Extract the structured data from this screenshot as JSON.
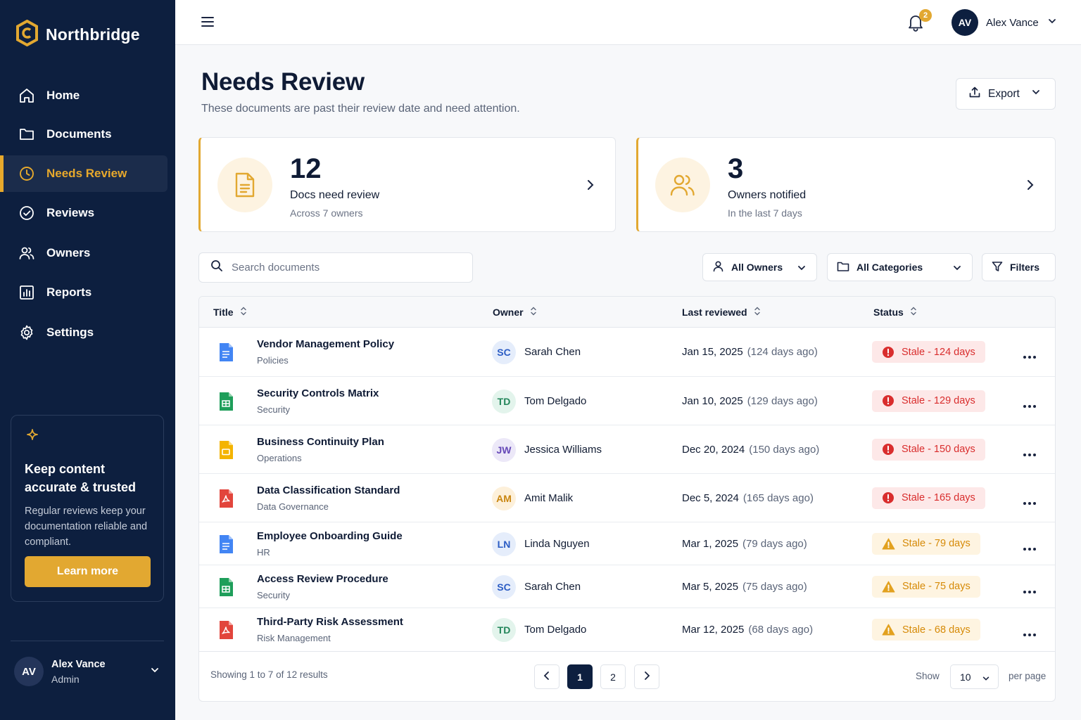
{
  "brand": {
    "name": "Northbridge"
  },
  "sidebar": {
    "items": [
      {
        "label": "Home",
        "icon": "home-icon"
      },
      {
        "label": "Documents",
        "icon": "folder-icon"
      },
      {
        "label": "Needs Review",
        "icon": "clock-icon",
        "active": true
      },
      {
        "label": "Reviews",
        "icon": "check-circle-icon"
      },
      {
        "label": "Owners",
        "icon": "users-icon"
      },
      {
        "label": "Reports",
        "icon": "bar-chart-icon"
      },
      {
        "label": "Settings",
        "icon": "gear-icon"
      }
    ],
    "promo": {
      "title": "Keep content accurate & trusted",
      "text": "Regular reviews keep your documentation reliable and compliant.",
      "button": "Learn more"
    },
    "user": {
      "initials": "AV",
      "name": "Alex Vance",
      "role": "Admin"
    }
  },
  "topbar": {
    "notification_count": "2",
    "user": {
      "initials": "AV",
      "name": "Alex Vance"
    }
  },
  "header": {
    "title": "Needs Review",
    "subtitle": "These documents are past their review date and need attention.",
    "export_label": "Export"
  },
  "stats": [
    {
      "value": "12",
      "label": "Docs need review",
      "sub": "Across 7 owners",
      "icon": "document-icon"
    },
    {
      "value": "3",
      "label": "Owners notified",
      "sub": "In the last 7 days",
      "icon": "users-icon"
    }
  ],
  "filters": {
    "search_placeholder": "Search documents",
    "owners": "All Owners",
    "categories": "All Categories",
    "more": "Filters"
  },
  "table": {
    "columns": [
      "Title",
      "Owner",
      "Last reviewed",
      "Status"
    ],
    "rows": [
      {
        "title": "Vendor Management Policy",
        "category": "Policies",
        "filetype": "doc",
        "owner_initials": "SC",
        "owner": "Sarah Chen",
        "date": "Jan 15, 2025",
        "ago": "(124 days ago)",
        "status": "Stale - 124 days",
        "severity": "red"
      },
      {
        "title": "Security Controls Matrix",
        "category": "Security",
        "filetype": "sheet",
        "owner_initials": "TD",
        "owner": "Tom Delgado",
        "date": "Jan 10, 2025",
        "ago": "(129 days ago)",
        "status": "Stale - 129 days",
        "severity": "red"
      },
      {
        "title": "Business Continuity Plan",
        "category": "Operations",
        "filetype": "slides",
        "owner_initials": "JW",
        "owner": "Jessica Williams",
        "date": "Dec 20, 2024",
        "ago": "(150 days ago)",
        "status": "Stale - 150 days",
        "severity": "red"
      },
      {
        "title": "Data Classification Standard",
        "category": "Data Governance",
        "filetype": "pdf",
        "owner_initials": "AM",
        "owner": "Amit Malik",
        "date": "Dec 5, 2024",
        "ago": "(165 days ago)",
        "status": "Stale - 165 days",
        "severity": "red"
      },
      {
        "title": "Employee Onboarding Guide",
        "category": "HR",
        "filetype": "doc",
        "owner_initials": "LN",
        "owner": "Linda Nguyen",
        "date": "Mar 1, 2025",
        "ago": "(79 days ago)",
        "status": "Stale - 79 days",
        "severity": "amber"
      },
      {
        "title": "Access Review Procedure",
        "category": "Security",
        "filetype": "sheet",
        "owner_initials": "SC",
        "owner": "Sarah Chen",
        "date": "Mar 5, 2025",
        "ago": "(75 days ago)",
        "status": "Stale - 75 days",
        "severity": "amber"
      },
      {
        "title": "Third-Party Risk Assessment",
        "category": "Risk Management",
        "filetype": "pdf",
        "owner_initials": "TD",
        "owner": "Tom Delgado",
        "date": "Mar 12, 2025",
        "ago": "(68 days ago)",
        "status": "Stale - 68 days",
        "severity": "amber"
      }
    ],
    "footer": {
      "summary": "Showing 1 to 7 of 12 results",
      "pages": [
        "1",
        "2"
      ],
      "current_page": "1",
      "show_label": "Show",
      "per_page_value": "10",
      "per_page_label": "per page"
    }
  },
  "colors": {
    "sidebar_bg": "#0d1f3f",
    "accent": "#e2a831",
    "stale_red": "#d92d2d",
    "stale_amber": "#d68a07"
  }
}
